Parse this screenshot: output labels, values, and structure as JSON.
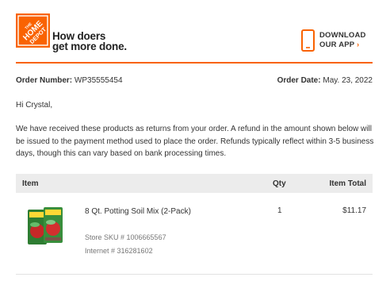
{
  "brand": {
    "logo_text": "THE HOME DEPOT",
    "tagline_line1": "How doers",
    "tagline_line2": "get more done.",
    "accent_color": "#f96302"
  },
  "app_promo": {
    "icon": "phone-icon",
    "line1": "DOWNLOAD",
    "line2": "OUR APP",
    "arrow": "›"
  },
  "order": {
    "number_label": "Order Number:",
    "number_value": "WP35555454",
    "date_label": "Order Date:",
    "date_value": "May. 23, 2022"
  },
  "greeting": "Hi Crystal,",
  "message": "We have received these products as returns from your order. A refund in the amount shown below will be issued to the payment method used to place the order. Refunds typically reflect within 3-5 business days, though this can vary based on bank processing times.",
  "table": {
    "headers": {
      "item": "Item",
      "qty": "Qty",
      "total": "Item Total"
    },
    "rows": [
      {
        "name": "8 Qt. Potting Soil Mix (2-Pack)",
        "qty": "1",
        "total": "$11.17",
        "store_sku": "Store SKU # 1006665567",
        "internet": "Internet # 316281602"
      }
    ]
  }
}
